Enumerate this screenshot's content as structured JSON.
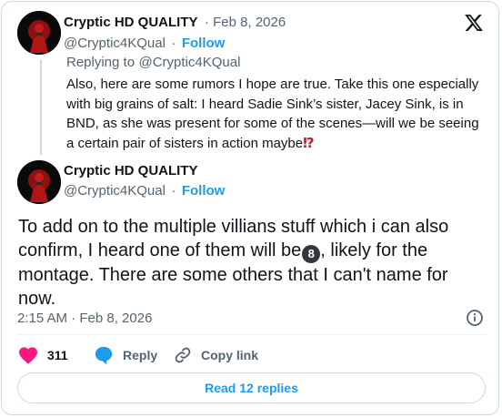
{
  "tweet1": {
    "display_name": "Cryptic HD QUALITY",
    "date": "· Feb 8, 2026",
    "handle": "@Cryptic4KQual",
    "dot": "·",
    "follow": "Follow",
    "replying_prefix": "Replying to",
    "replying_to": "@Cryptic4KQual",
    "text": "Also, here are some rumors I hope are true. Take this one especially with big grains of salt: I heard Sadie Sink’s sister, Jacey Sink, is in BND, as she was present for some of the scenes—will we be seeing a certain pair of sisters in action maybe",
    "emoji": "⁉"
  },
  "tweet2": {
    "display_name": "Cryptic HD QUALITY",
    "handle": "@Cryptic4KQual",
    "dot": "·",
    "follow": "Follow",
    "text_before": "To add on to the multiple villians stuff which i can also confirm, I heard one of them will be",
    "emoji": "8",
    "text_after": ", likely for the montage. There are some others that I can't name for now.",
    "timestamp": "2:15 AM · Feb 8, 2026"
  },
  "actions": {
    "likes": "311",
    "reply": "Reply",
    "copy_link": "Copy link",
    "read_replies": "Read 12 replies"
  },
  "icons": [
    "x-logo-icon",
    "heart-icon",
    "reply-icon",
    "link-icon",
    "info-icon"
  ],
  "colors": {
    "accent": "#1d9bf0",
    "like": "#f91880",
    "muted": "#536471",
    "border": "#cfd9de"
  }
}
